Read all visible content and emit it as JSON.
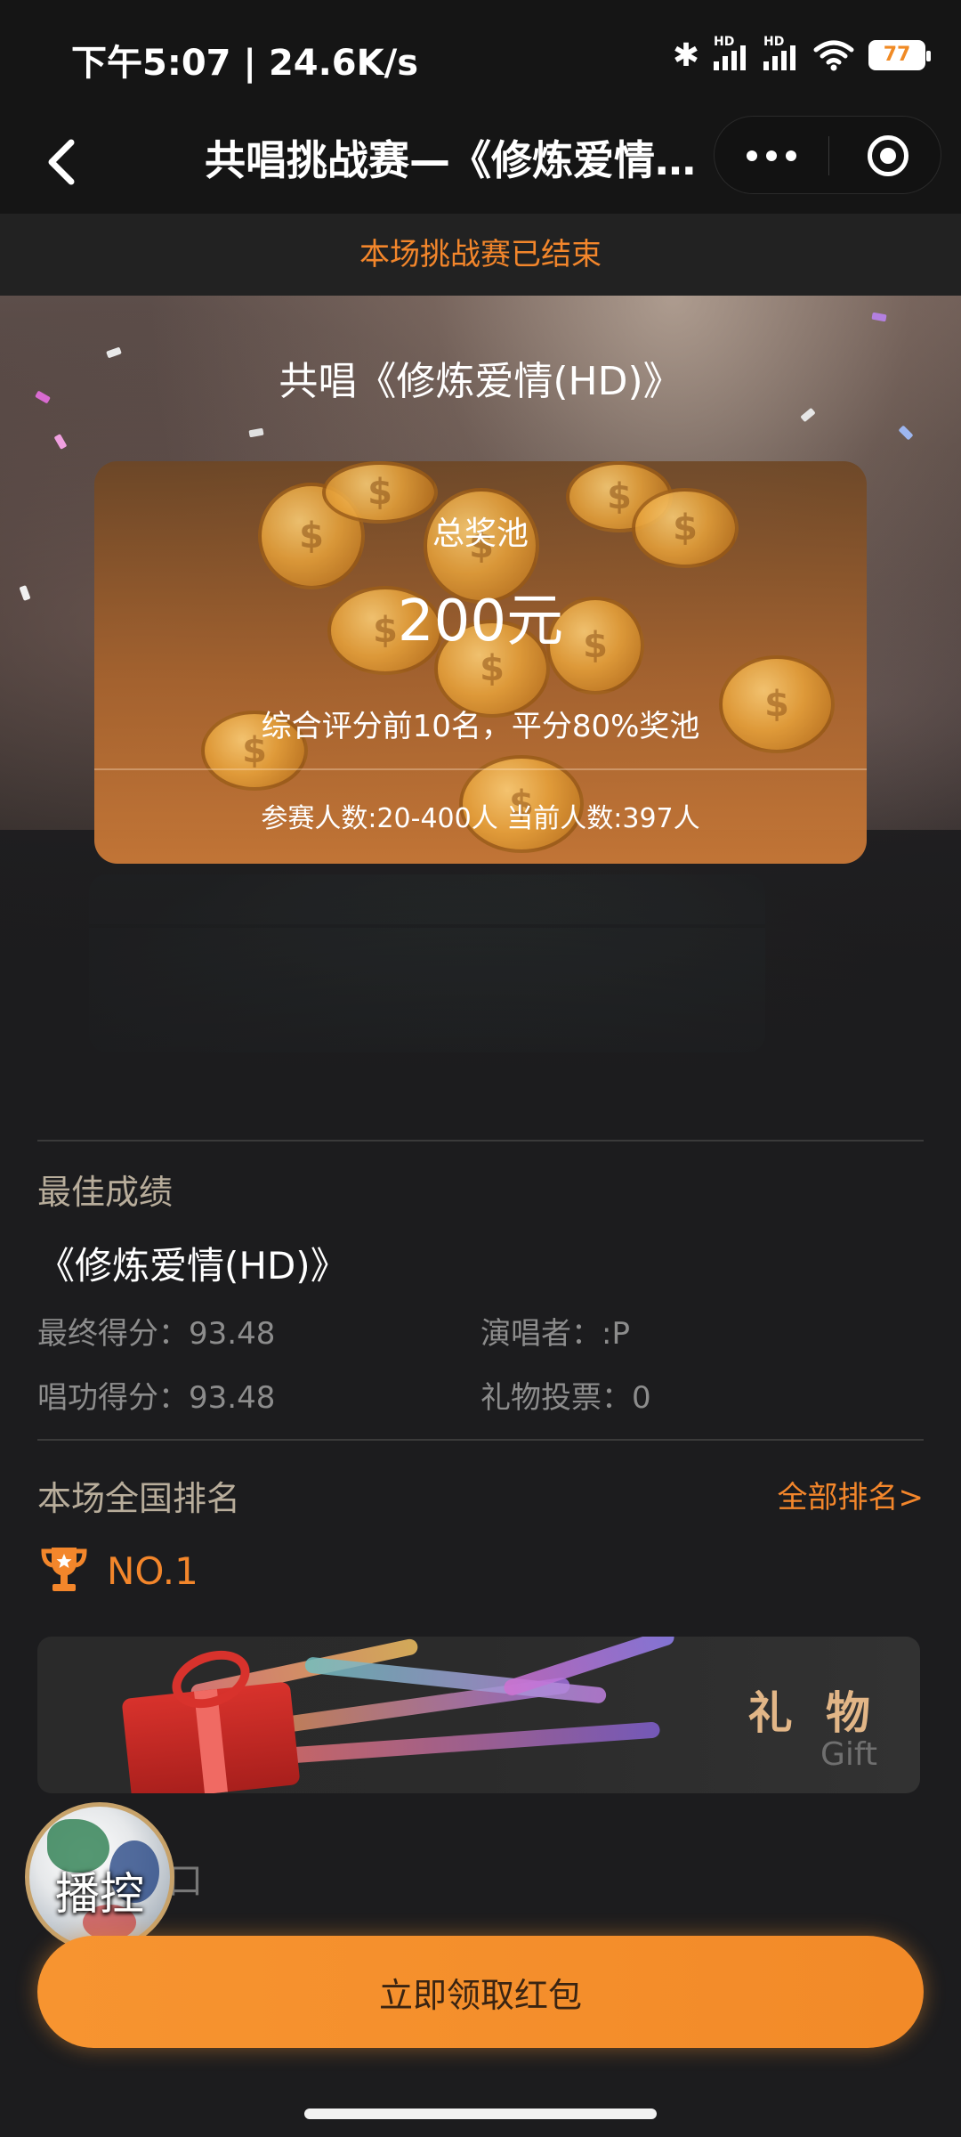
{
  "status_bar": {
    "time": "下午5:07 | 24.6K/s",
    "battery": "77",
    "network_badge": "HD"
  },
  "nav": {
    "title": "共唱挑战赛—《修炼爱情…",
    "icons": [
      "chevron-left-icon",
      "more-dots-icon",
      "target-icon"
    ]
  },
  "notice": "本场挑战赛已结束",
  "hero": {
    "title": "共唱《修炼爱情(HD)》"
  },
  "prize": {
    "label": "总奖池",
    "amount": "200元",
    "rule": "综合评分前10名，平分80%奖池",
    "participants": "参赛人数:20-400人 当前人数:397人"
  },
  "best": {
    "label": "最佳成绩",
    "song": "《修炼爱情(HD)》",
    "final_score": "最终得分：93.48",
    "singer": "演唱者：:P",
    "skill_score": "唱功得分：93.48",
    "gift_votes": "礼物投票：0"
  },
  "ranking": {
    "label": "本场全国排名",
    "all_link": "全部排名>",
    "position": "NO.1"
  },
  "gift_banner": {
    "cn": "礼 物",
    "en": "Gift"
  },
  "float_ball": {
    "label": "播控"
  },
  "behind_text": "口",
  "cta": {
    "label": "立即领取红包"
  },
  "colors": {
    "accent": "#f3862b",
    "background": "#1c1c1e",
    "cta": "#f79430",
    "gold_text": "#e2b687"
  }
}
